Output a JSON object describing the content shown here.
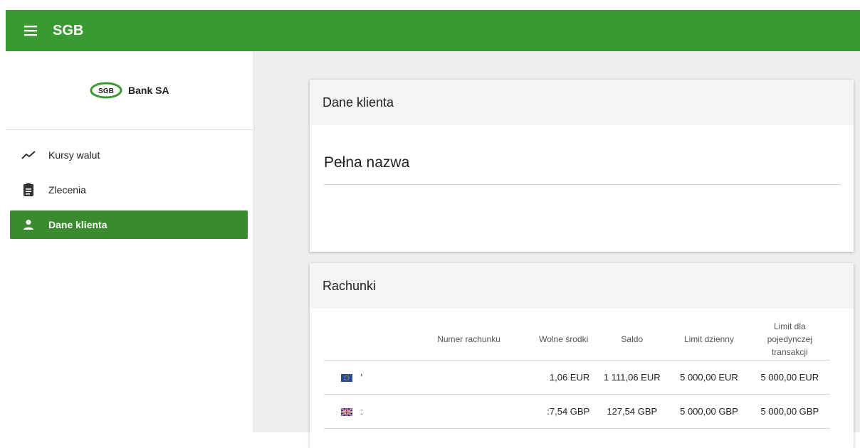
{
  "app": {
    "title": "SGB"
  },
  "sidebar": {
    "logo": {
      "badge": "SGB",
      "text": "Bank SA"
    },
    "items": [
      {
        "label": "Kursy walut",
        "icon": "trending-up-icon",
        "active": false
      },
      {
        "label": "Zlecenia",
        "icon": "clipboard-icon",
        "active": false
      },
      {
        "label": "Dane klienta",
        "icon": "person-icon",
        "active": true
      }
    ]
  },
  "client_card": {
    "title": "Dane klienta",
    "field_label": "Pełna nazwa"
  },
  "accounts_card": {
    "title": "Rachunki",
    "columns": [
      "Numer rachunku",
      "Wolne środki",
      "Saldo",
      "Limit dzienny",
      "Limit dla pojedynczej transakcji"
    ],
    "rows": [
      {
        "flag": "eu-flag-icon",
        "account": "'",
        "available": "1,06 EUR",
        "balance": "1 111,06 EUR",
        "daily_limit": "5 000,00 EUR",
        "tx_limit": "5 000,00 EUR"
      },
      {
        "flag": "uk-flag-icon",
        "account": ":",
        "available": ":7,54 GBP",
        "balance": "127,54 GBP",
        "daily_limit": "5 000,00 GBP",
        "tx_limit": "5 000,00 GBP"
      }
    ]
  },
  "colors": {
    "brand": "#3a9a32",
    "active_nav": "#3a8a2e",
    "background": "#eeeeee"
  }
}
